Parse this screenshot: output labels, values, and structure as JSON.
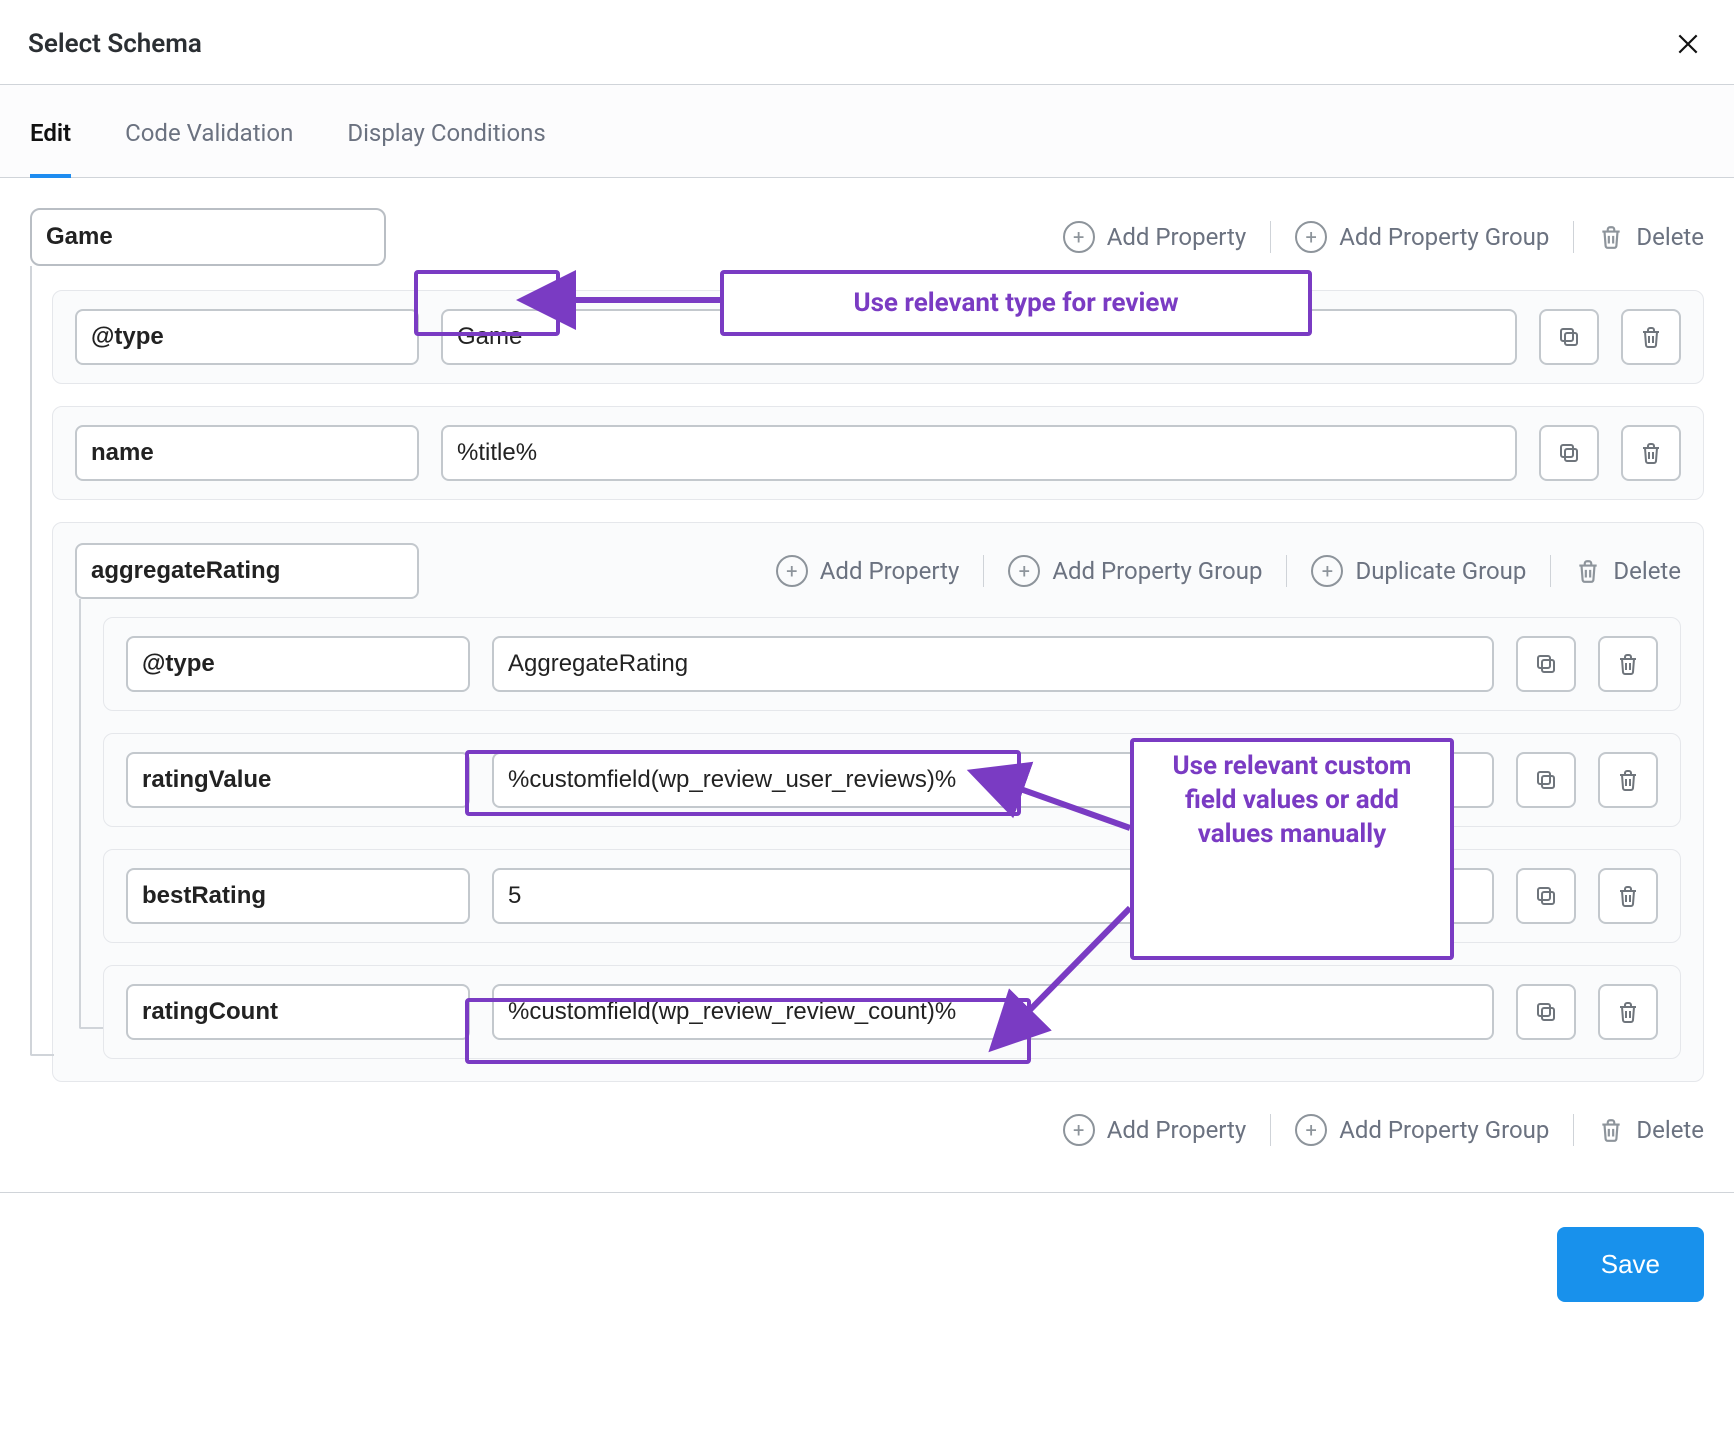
{
  "header": {
    "title": "Select Schema"
  },
  "tabs": [
    {
      "id": "edit",
      "label": "Edit",
      "active": true
    },
    {
      "id": "code",
      "label": "Code Validation",
      "active": false
    },
    {
      "id": "display",
      "label": "Display Conditions",
      "active": false
    }
  ],
  "top_actions": {
    "add_property": "Add Property",
    "add_property_group": "Add Property Group",
    "delete": "Delete"
  },
  "schema": {
    "root_type_chip": "Game",
    "properties": [
      {
        "key": "@type",
        "value": "Game"
      },
      {
        "key": "name",
        "value": "%title%"
      }
    ],
    "group": {
      "chip": "aggregateRating",
      "actions": {
        "add_property": "Add Property",
        "add_property_group": "Add Property Group",
        "duplicate_group": "Duplicate Group",
        "delete": "Delete"
      },
      "properties": [
        {
          "key": "@type",
          "value": "AggregateRating"
        },
        {
          "key": "ratingValue",
          "value": "%customfield(wp_review_user_reviews)%"
        },
        {
          "key": "bestRating",
          "value": "5"
        },
        {
          "key": "ratingCount",
          "value": "%customfield(wp_review_review_count)%"
        }
      ]
    }
  },
  "bottom_actions": {
    "add_property": "Add Property",
    "add_property_group": "Add Property Group",
    "delete": "Delete"
  },
  "save_label": "Save",
  "annotations": {
    "type_note": "Use relevant type for review",
    "custom_note": "Use relevant custom field values or add values manually"
  }
}
